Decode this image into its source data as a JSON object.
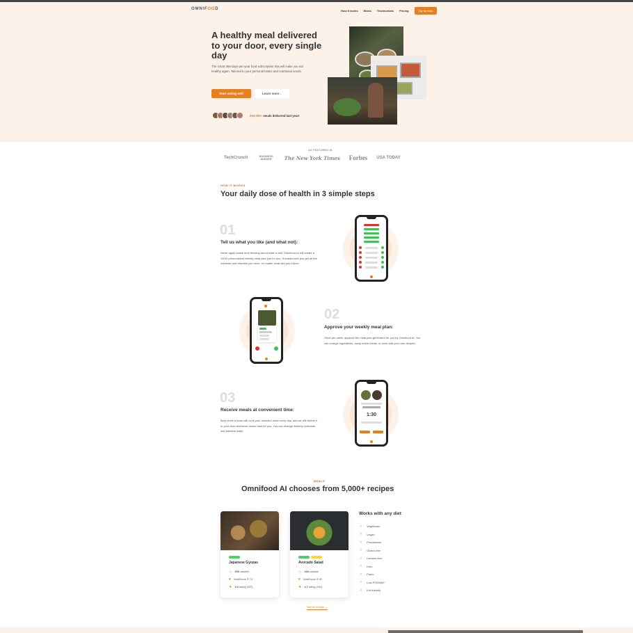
{
  "header": {
    "logo_prefix": "OMNIF",
    "logo_accent": "OO",
    "logo_suffix": "D",
    "nav": [
      "How it works",
      "Meals",
      "Testimonials",
      "Pricing"
    ],
    "cta": "Try for free"
  },
  "hero": {
    "title": "A healthy meal delivered to your door, every single day",
    "description": "The smart 365-days-per-year food subscription that will make you eat healthy again. Tailored to your personal tastes and nutritional needs.",
    "primary_button": "Start eating well",
    "secondary_button": "Learn more ↓",
    "delivered_count": "250,000+",
    "delivered_text": " meals delivered last year!"
  },
  "featured": {
    "label": "AS FEATURED IN",
    "logos": [
      "TechCrunch",
      "BUSINESS INSIDER",
      "The New York Times",
      "Forbes",
      "USA TODAY"
    ]
  },
  "how": {
    "label": "HOW IT WORKS",
    "title": "Your daily dose of health in 3 simple steps",
    "steps": [
      {
        "num": "01",
        "title": "Tell us what you like (and what not):",
        "desc": "Never again waste time thinking about what to eat! Omnifood AI will create a 100% personalized weekly meal plan just for you. It makes sure you get all the nutrients and vitamins you need, no matter what diet you follow!"
      },
      {
        "num": "02",
        "title": "Approve your weekly meal plan:",
        "desc": "Once per week, approve the meal plan generated for you by Omnifood AI. You can change ingredients, swap entire meals, or even add your own recipes."
      },
      {
        "num": "03",
        "title": "Receive meals at convenient time:",
        "desc": "Best chefs in town will cook your selected meal every day, and we will deliver it to your door whenever works best for you. You can change delivery schedule and address daily!"
      }
    ],
    "phone_time": "1:30"
  },
  "meals": {
    "label": "MEALS",
    "title": "Omnifood AI chooses from 5,000+ recipes",
    "cards": [
      {
        "name": "Japanese Gyozas",
        "calories_value": "650",
        "calories_label": " calories",
        "nutri": "NutriScore ® 74",
        "rating_value": "4.9",
        "rating_label": " rating (537)"
      },
      {
        "name": "Avocado Salad",
        "calories_value": "400",
        "calories_label": " calories",
        "nutri": "NutriScore ® 92",
        "rating_value": "4.7",
        "rating_label": " rating (441)"
      }
    ],
    "diet_title": "Works with any diet",
    "diets": [
      "Vegetarian",
      "Vegan",
      "Pescatarian",
      "Gluten-free",
      "Lactose-free",
      "Keto",
      "Paleo",
      "Low FODMAP",
      "Kid-friendly"
    ],
    "all_recipes": "See all recipes →"
  },
  "colors": {
    "accent": "#e67e22",
    "hero_bg": "#fdf2e9",
    "vegan_tag": "#51cf66",
    "paleo_tag": "#ffd43b"
  }
}
